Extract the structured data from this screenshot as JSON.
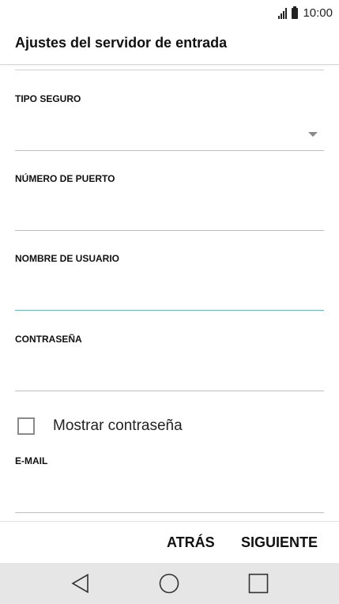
{
  "status_bar": {
    "time": "10:00",
    "signal_icon": "signal-icon",
    "battery_icon": "battery-icon"
  },
  "header": {
    "title": "Ajustes del servidor de entrada"
  },
  "form": {
    "fields": [
      {
        "label": "TIPO SEGURO",
        "value": "",
        "type": "dropdown"
      },
      {
        "label": "NÚMERO DE PUERTO",
        "value": "",
        "type": "text"
      },
      {
        "label": "NOMBRE DE USUARIO",
        "value": "",
        "type": "text",
        "focused": true
      },
      {
        "label": "CONTRASEÑA",
        "value": "",
        "type": "password"
      },
      {
        "label": "E-MAIL",
        "value": "",
        "type": "text"
      }
    ],
    "show_password": {
      "label": "Mostrar contraseña",
      "checked": false
    }
  },
  "actions": {
    "back_label": "ATRÁS",
    "next_label": "SIGUIENTE"
  },
  "nav": {
    "back_icon": "triangle-back-icon",
    "home_icon": "circle-home-icon",
    "recent_icon": "square-recent-icon"
  },
  "colors": {
    "focus_accent": "#3cc7d3",
    "nav_background": "#e6e6e6"
  }
}
